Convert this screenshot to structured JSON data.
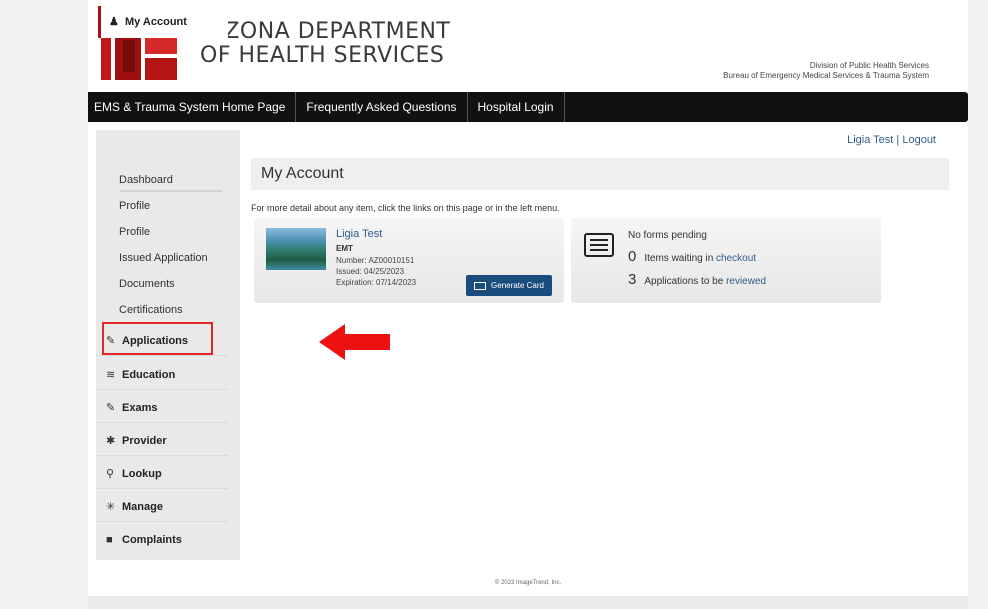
{
  "header": {
    "agency_line1": "ARIZONA DEPARTMENT",
    "agency_line2": "OF HEALTH SERVICES",
    "division_line1": "Division of Public Health Services",
    "division_line2": "Bureau of Emergency Medical Services & Trauma System"
  },
  "nav": {
    "items": [
      "EMS & Trauma System Home Page",
      "Frequently Asked Questions",
      "Hospital Login"
    ]
  },
  "sidebar": {
    "account_header": "My Account",
    "sub_items": [
      "Dashboard",
      "Profile",
      "Profile",
      "Issued Application",
      "Documents",
      "Certifications"
    ],
    "items": [
      {
        "label": "Applications",
        "icon": "edit-icon"
      },
      {
        "label": "Education",
        "icon": "graduation-icon"
      },
      {
        "label": "Exams",
        "icon": "edit-icon"
      },
      {
        "label": "Provider",
        "icon": "asterisk-icon"
      },
      {
        "label": "Lookup",
        "icon": "search-icon"
      },
      {
        "label": "Manage",
        "icon": "wand-icon"
      },
      {
        "label": "Complaints",
        "icon": "folder-icon"
      }
    ]
  },
  "user": {
    "name": "Ligia Test",
    "separator": " | ",
    "logout": "Logout"
  },
  "main": {
    "title": "My Account",
    "intro": "For more detail about any item, click the links on this page or in the left menu."
  },
  "cert_card": {
    "name": "Ligia Test",
    "type": "EMT",
    "number": "Number:  AZ00010151",
    "issued": "Issued:  04/25/2023",
    "expiration": "Expiration:  07/14/2023",
    "button": "Generate Card"
  },
  "status_card": {
    "line1": "No forms pending",
    "checkout_count": "0",
    "checkout_text": "Items waiting in ",
    "checkout_link": "checkout",
    "review_count": "3",
    "review_text": "Applications to be ",
    "review_link": "reviewed"
  },
  "footer": {
    "text": "© 2023 ImageTrend, Inc."
  },
  "colors": {
    "accent_red": "#b40c0c",
    "nav_bg": "#111111",
    "link_blue": "#2f5d8a",
    "button_blue": "#1a4c7e",
    "arrow_red": "#ee1111"
  }
}
